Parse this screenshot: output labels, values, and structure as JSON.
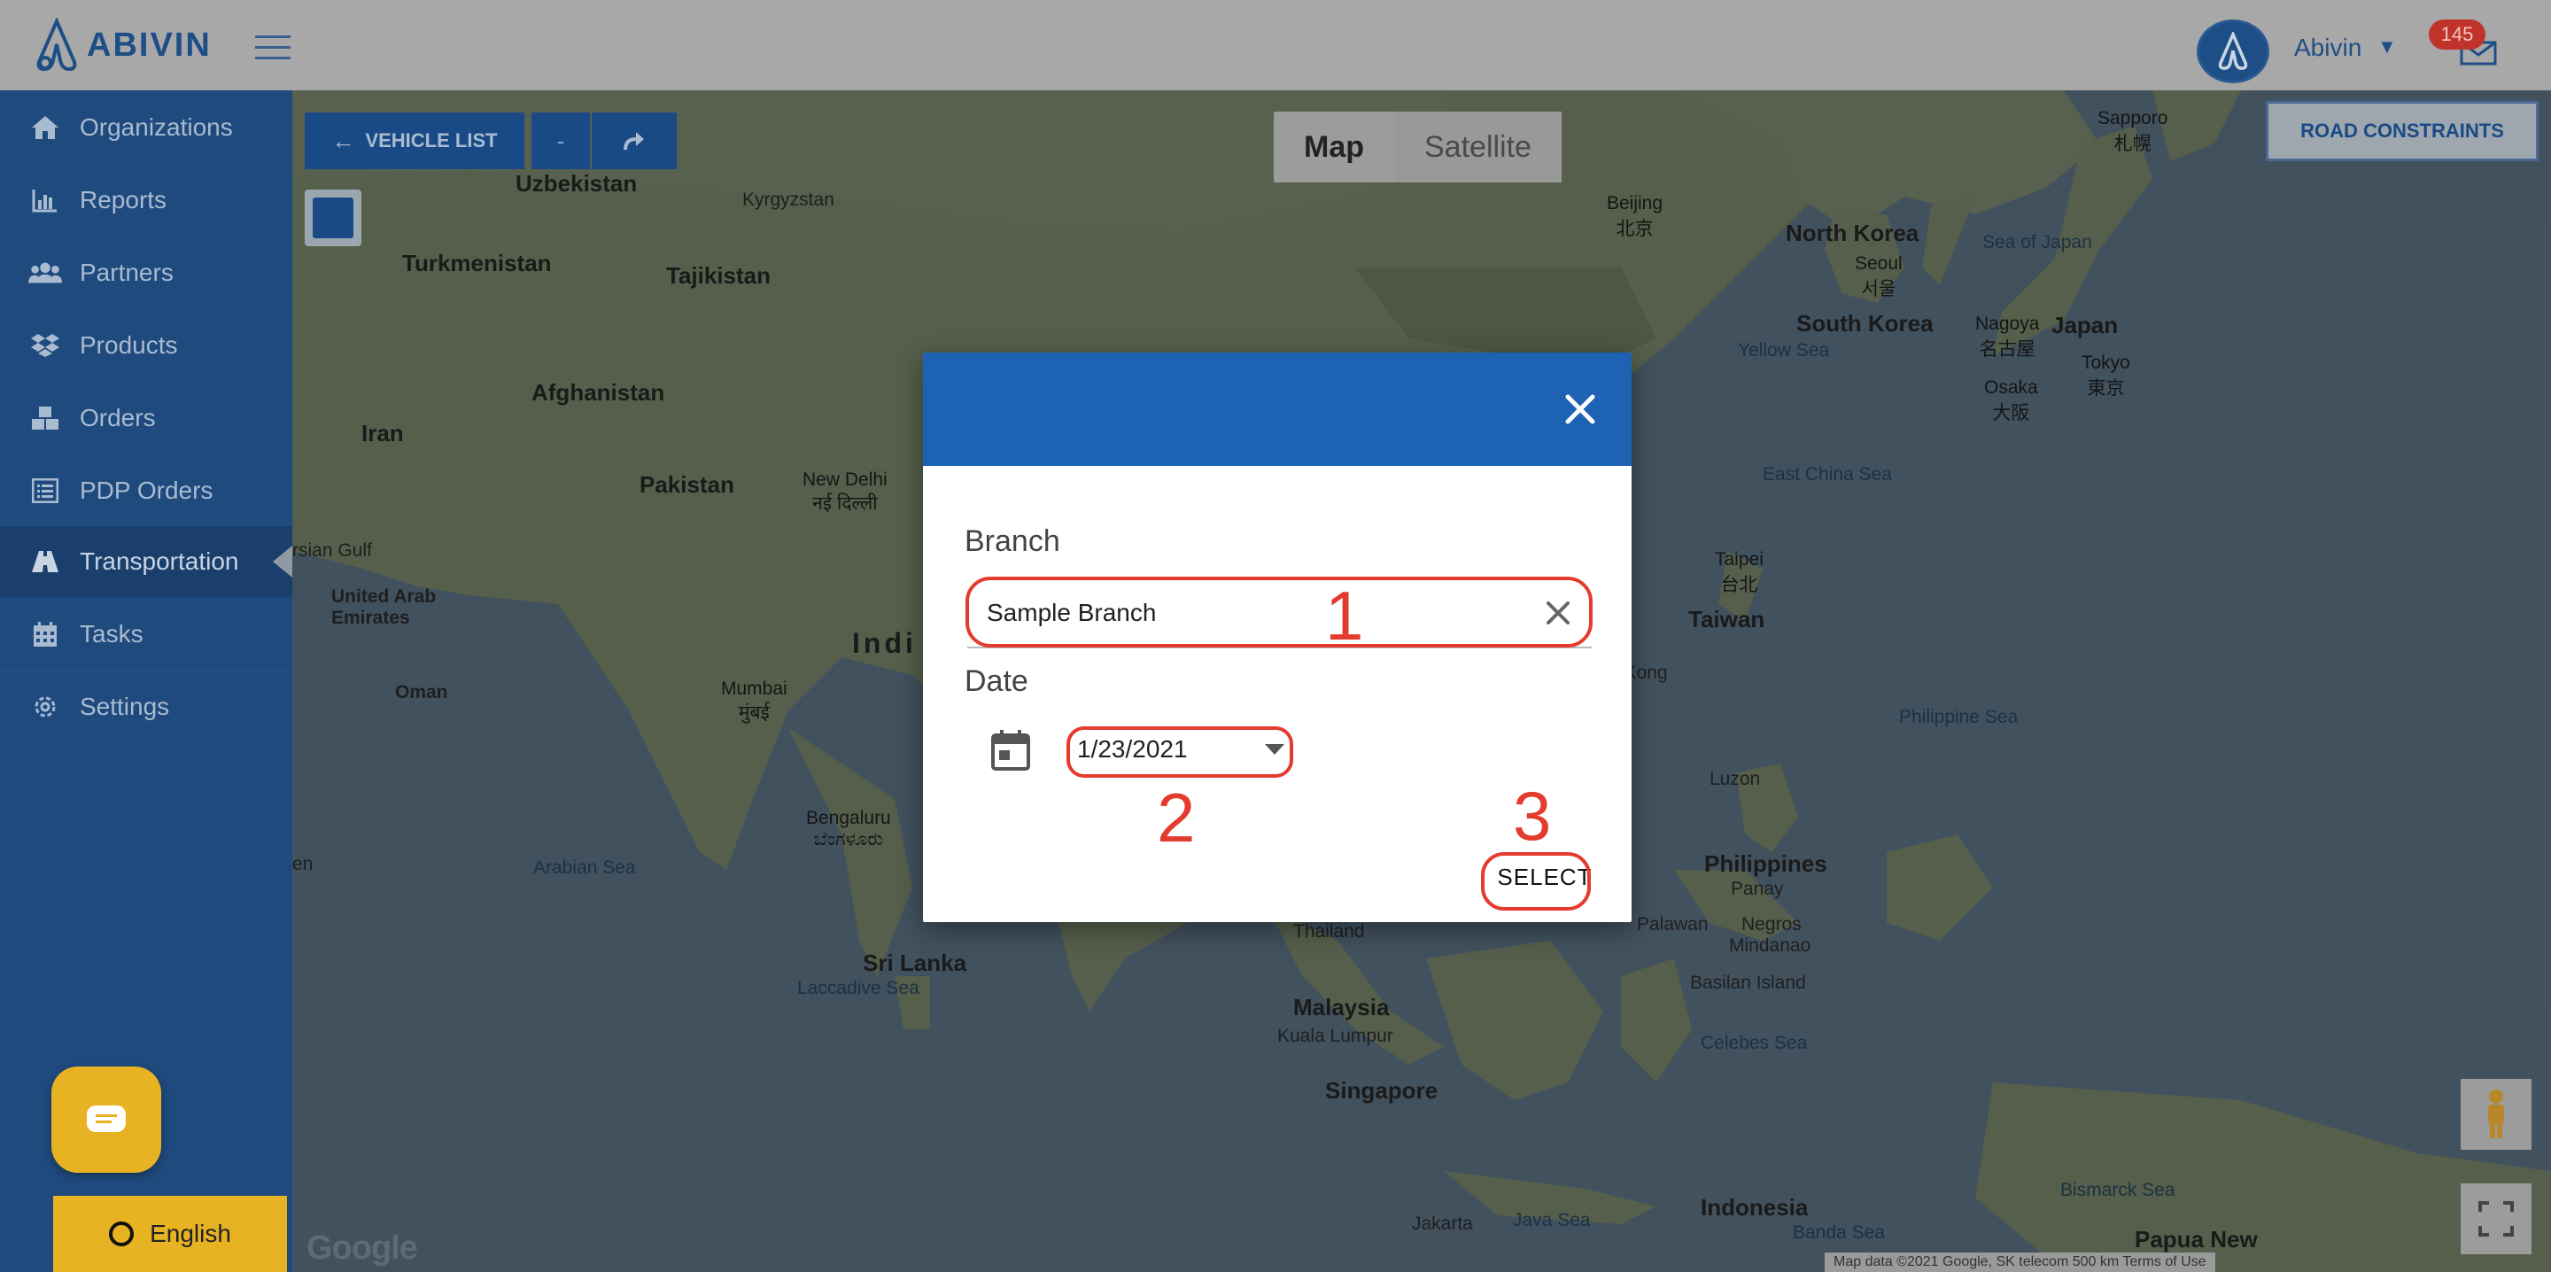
{
  "header": {
    "logo_text": "ABIVIN",
    "user_name": "Abivin",
    "notification_count": "145"
  },
  "sidebar": {
    "items": [
      {
        "label": "Organizations",
        "icon": "home-icon"
      },
      {
        "label": "Reports",
        "icon": "bar-chart-icon"
      },
      {
        "label": "Partners",
        "icon": "users-icon"
      },
      {
        "label": "Products",
        "icon": "dropbox-icon"
      },
      {
        "label": "Orders",
        "icon": "cubes-icon"
      },
      {
        "label": "PDP Orders",
        "icon": "list-icon"
      },
      {
        "label": "Transportation",
        "icon": "road-icon"
      },
      {
        "label": "Tasks",
        "icon": "calendar-icon"
      },
      {
        "label": "Settings",
        "icon": "gear-icon"
      }
    ],
    "language_label": "English"
  },
  "map_controls": {
    "vehicle_list_label": "VEHICLE LIST",
    "minus_label": "-",
    "map_type_map": "Map",
    "map_type_satellite": "Satellite",
    "road_constraints_label": "ROAD CONSTRAINTS",
    "google_logo": "Google",
    "attribution": "Map data ©2021 Google, SK telecom   500 km   Terms of Use"
  },
  "map_labels": {
    "uzbekistan": "Uzbekistan",
    "kyrgyzstan": "Kyrgyzstan",
    "turkmenistan": "Turkmenistan",
    "tajikistan": "Tajikistan",
    "afghanistan": "Afghanistan",
    "iran": "Iran",
    "pakistan": "Pakistan",
    "new_delhi": "New Delhi\nनई दिल्ली",
    "persian_gulf": "rsian Gulf",
    "uae": "United Arab\nEmirates",
    "oman": "Oman",
    "india": "Indi",
    "mumbai": "Mumbai\nमुंबई",
    "bengaluru": "Bengaluru\nಬೆಂಗಳೂರು",
    "arabian_sea": "Arabian Sea",
    "sri_lanka": "Sri Lanka",
    "laccadive_sea": "Laccadive Sea",
    "en": "en",
    "sapporo": "Sapporo\n札幌",
    "beijing": "Beijing\n北京",
    "north_korea": "North Korea",
    "seoul": "Seoul\n서울",
    "sea_of_japan": "Sea of Japan",
    "south_korea": "South Korea",
    "yellow_sea": "Yellow Sea",
    "nagoya": "Nagoya\n名古屋",
    "japan": "Japan",
    "tokyo": "Tokyo\n東京",
    "osaka": "Osaka\n大阪",
    "east_china_sea": "East China Sea",
    "taipei": "Taipei\n台北",
    "taiwan": "Taiwan",
    "hong_kong": "g Kong",
    "philippine_sea": "Philippine Sea",
    "luzon": "Luzon",
    "philippines": "Philippines",
    "panay": "Panay",
    "palawan": "Palawan",
    "negros": "Negros",
    "mindanao": "Mindanao",
    "basilan": "Basilan Island",
    "thailand": "Thailand",
    "malaysia": "Malaysia",
    "kuala_lumpur": "Kuala Lumpur",
    "singapore": "Singapore",
    "celebes_sea": "Celebes Sea",
    "java_sea": "Java Sea",
    "jakarta": "Jakarta",
    "indonesia": "Indonesia",
    "banda_sea": "Banda Sea",
    "bismarck_sea": "Bismarck Sea",
    "papua": "Papua New"
  },
  "dialog": {
    "branch_label": "Branch",
    "branch_value": "Sample Branch",
    "date_label": "Date",
    "date_value": "1/23/2021",
    "select_label": "SELECT",
    "annotation_1": "1",
    "annotation_2": "2",
    "annotation_3": "3"
  },
  "colors": {
    "primary": "#1e63b3",
    "sidebar": "#1f4a7e",
    "annotation": "#e33b2e",
    "accent": "#e8b322"
  }
}
